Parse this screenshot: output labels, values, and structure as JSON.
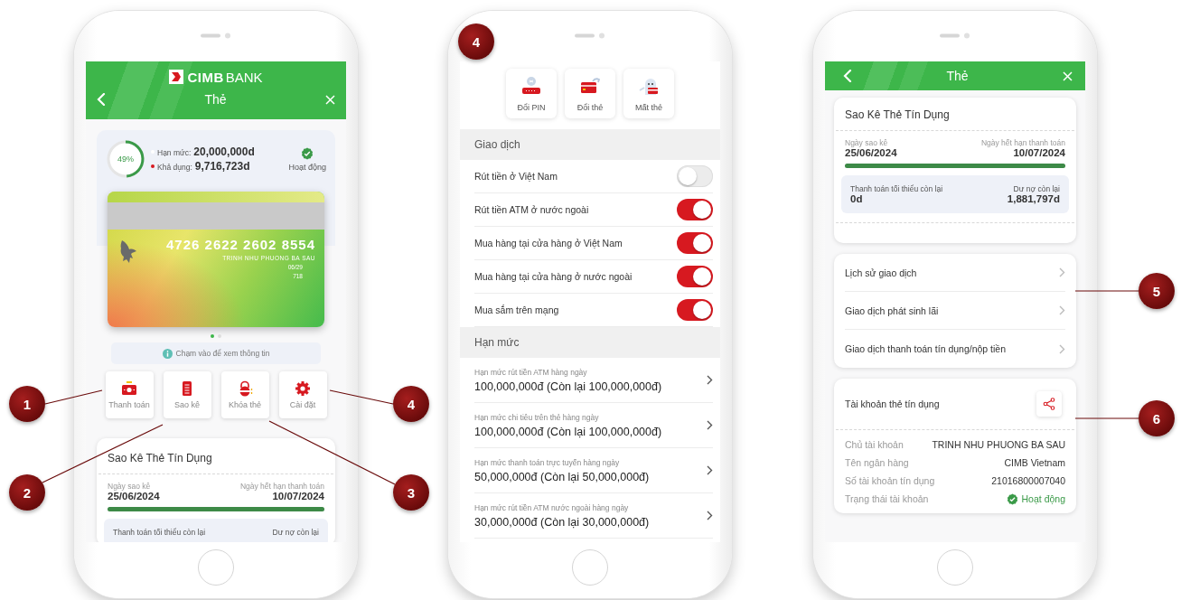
{
  "callouts": [
    {
      "label": "1"
    },
    {
      "label": "2"
    },
    {
      "label": "3"
    },
    {
      "label": "4"
    },
    {
      "label": "4"
    },
    {
      "label": "5"
    },
    {
      "label": "6"
    }
  ],
  "phone_1": {
    "header": {
      "logo_bold": "CIMB",
      "logo_light": "BANK",
      "title": "Thẻ"
    },
    "summary": {
      "percent": "49%",
      "level": 0.49,
      "limit_label": "Hạn mức:",
      "limit_value": "20,000,000d",
      "available_label": "Khả dụng:",
      "available_value": "9,716,723d",
      "status": "Hoạt động"
    },
    "card": {
      "number": "4726 2622 2602 8554",
      "holder": "TRINH NHU PHUONG BA SAU",
      "expiry": "06/29",
      "cvv": "718"
    },
    "pager": [
      {
        "selected": true
      },
      {
        "selected": false
      }
    ],
    "hint": "Chạm vào để xem thông tin",
    "actions": [
      {
        "label": "Thanh toán"
      },
      {
        "label": "Sao kê"
      },
      {
        "label": "Khóa thẻ"
      },
      {
        "label": "Cài đặt"
      }
    ],
    "statement": {
      "title": "Sao Kê Thẻ Tín Dụng",
      "statement_date_label": "Ngày sao kê",
      "statement_date": "25/06/2024",
      "due_date_label": "Ngày hết hạn thanh toán",
      "due_date": "10/07/2024",
      "level": 1,
      "min_payment_label": "Thanh toán tối thiểu còn lại",
      "balance_label": "Dư nợ còn lại"
    }
  },
  "phone_2": {
    "actions": [
      {
        "label": "Đổi PIN"
      },
      {
        "label": "Đổi thẻ"
      },
      {
        "label": "Mất thẻ"
      }
    ],
    "transactions": {
      "title": "Giao dịch",
      "toggles": [
        {
          "label": "Rút tiền ở Việt Nam",
          "on": false
        },
        {
          "label": "Rút tiền ATM ở nước ngoài",
          "on": true
        },
        {
          "label": "Mua hàng tại cửa hàng ở Việt Nam",
          "on": true
        },
        {
          "label": "Mua hàng tại cửa hàng ở nước ngoài",
          "on": true
        },
        {
          "label": "Mua sắm trên mạng",
          "on": true
        }
      ]
    },
    "limits": {
      "title": "Hạn mức",
      "items": [
        {
          "label": "Hạn mức rút tiền ATM hàng ngày",
          "value": "100,000,000đ (Còn lại 100,000,000đ)"
        },
        {
          "label": "Hạn mức chi tiêu trên thẻ hàng ngày",
          "value": "100,000,000đ (Còn lại 100,000,000đ)"
        },
        {
          "label": "Hạn mức thanh toán trực tuyến hàng ngày",
          "value": "50,000,000đ (Còn lại 50,000,000đ)"
        },
        {
          "label": "Hạn mức rút tiền ATM nước ngoài hàng ngày",
          "value": "30,000,000đ (Còn lại 30,000,000đ)"
        }
      ]
    }
  },
  "phone_3": {
    "header": {
      "title": "Thẻ"
    },
    "statement": {
      "title": "Sao Kê Thẻ Tín Dụng",
      "statement_date_label": "Ngày sao kê",
      "statement_date": "25/06/2024",
      "due_date_label": "Ngày hết hạn thanh toán",
      "due_date": "10/07/2024",
      "level": 1,
      "min_payment_label": "Thanh toán tối thiểu còn lại",
      "min_payment": "0d",
      "balance_label": "Dư nợ còn lại",
      "balance": "1,881,797d"
    },
    "links": [
      {
        "label": "Lịch sử giao dịch"
      },
      {
        "label": "Giao dịch phát sinh lãi"
      },
      {
        "label": "Giao dịch thanh toán tín dụng/nộp tiền"
      }
    ],
    "account": {
      "title": "Tài khoản thẻ tín dụng",
      "rows": [
        {
          "kind": "text",
          "label": "Chủ tài khoản",
          "value": "TRINH NHU PHUONG BA SAU"
        },
        {
          "kind": "text",
          "label": "Tên ngân hàng",
          "value": "CIMB Vietnam"
        },
        {
          "kind": "text",
          "label": "Số tài khoản tín dụng",
          "value": "21016800007040"
        },
        {
          "kind": "status",
          "label": "Trạng thái tài khoản",
          "value": "Hoạt động"
        }
      ]
    }
  }
}
